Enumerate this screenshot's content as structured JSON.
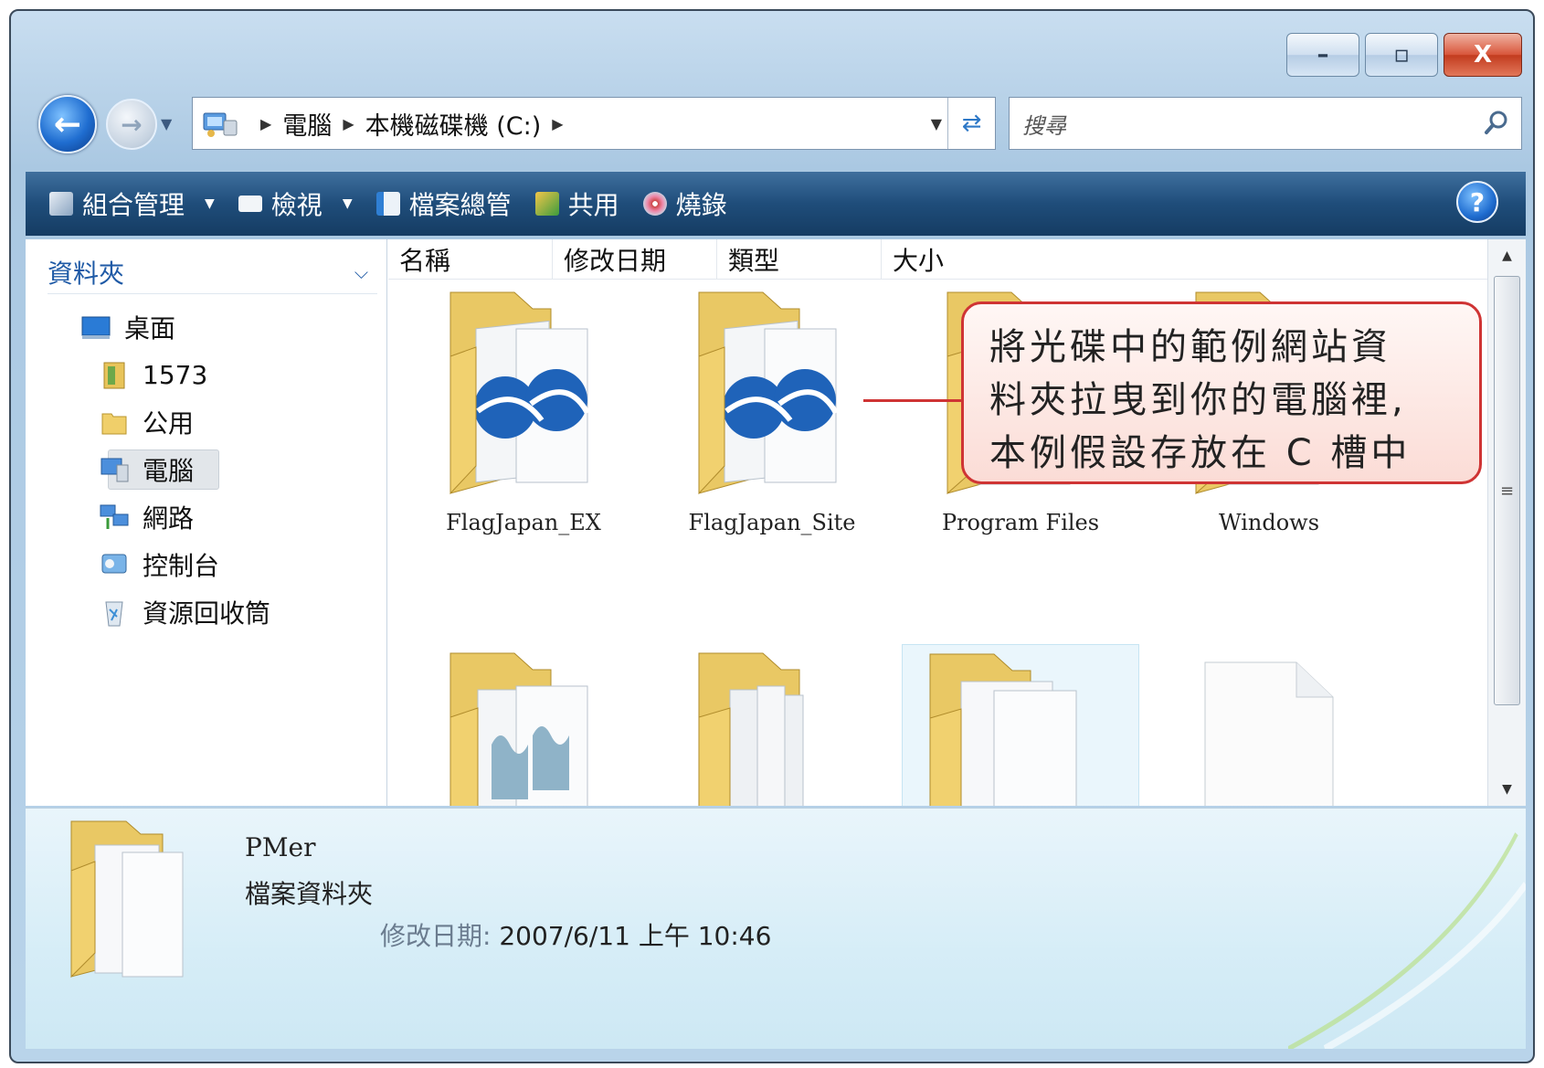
{
  "window": {
    "caption_buttons": {
      "minimize": "–",
      "maximize": "▫",
      "close": "X"
    }
  },
  "navbar": {
    "back_icon": "back-arrow-icon",
    "forward_icon": "forward-arrow-icon",
    "address_segments": [
      "電腦",
      "本機磁碟機 (C:)"
    ],
    "search_placeholder": "搜尋"
  },
  "toolbar": {
    "items": [
      {
        "label": "組合管理",
        "has_menu": true
      },
      {
        "label": "檢視",
        "has_menu": true
      },
      {
        "label": "檔案總管",
        "has_menu": false
      },
      {
        "label": "共用",
        "has_menu": false
      },
      {
        "label": "燒錄",
        "has_menu": false
      }
    ],
    "help": "?"
  },
  "nav_pane": {
    "header": "資料夾",
    "items": [
      {
        "label": "桌面",
        "icon": "desktop-icon"
      },
      {
        "label": "1573",
        "icon": "user-folder-icon"
      },
      {
        "label": "公用",
        "icon": "public-folder-icon"
      },
      {
        "label": "電腦",
        "icon": "computer-icon",
        "selected": true
      },
      {
        "label": "網路",
        "icon": "network-icon"
      },
      {
        "label": "控制台",
        "icon": "control-panel-icon"
      },
      {
        "label": "資源回收筒",
        "icon": "recycle-bin-icon"
      }
    ]
  },
  "content": {
    "columns": [
      "名稱",
      "修改日期",
      "類型",
      "大小"
    ],
    "files": [
      {
        "name": "FlagJapan_EX",
        "kind": "web-folder"
      },
      {
        "name": "FlagJapan_Site",
        "kind": "web-folder"
      },
      {
        "name": "Program Files",
        "kind": "folder"
      },
      {
        "name": "Windows",
        "kind": "folder"
      },
      {
        "name": "",
        "kind": "image-folder"
      },
      {
        "name": "",
        "kind": "folder"
      },
      {
        "name": "",
        "kind": "doc-folder",
        "highlighted": true
      },
      {
        "name": "",
        "kind": "file"
      }
    ]
  },
  "callout": {
    "lines": [
      "將光碟中的範例網站資",
      "料夾拉曳到你的電腦裡,",
      "本例假設存放在 C 槽中"
    ],
    "color": "#cf3434"
  },
  "details": {
    "name": "PMer",
    "type": "檔案資料夾",
    "modified_label": "修改日期:",
    "modified_value": "2007/6/11 上午 10:46"
  }
}
